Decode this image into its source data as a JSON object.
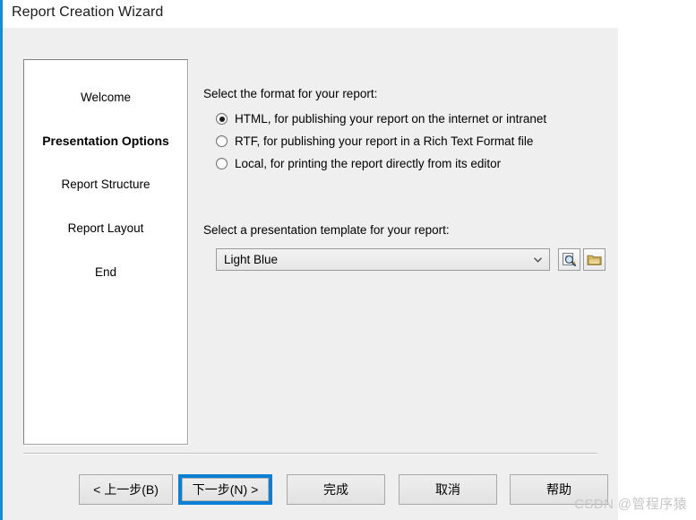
{
  "window": {
    "title": "Report Creation Wizard",
    "accent_color": "#1a8ad4",
    "dialog_background": "#efefef"
  },
  "steps_panel": {
    "items": [
      {
        "label": "Welcome",
        "active": false
      },
      {
        "label": "Presentation Options",
        "active": true
      },
      {
        "label": "Report Structure",
        "active": false
      },
      {
        "label": "Report Layout",
        "active": false
      },
      {
        "label": "End",
        "active": false
      }
    ]
  },
  "content": {
    "format_prompt": "Select the format for your report:",
    "format_options": [
      {
        "label": "HTML, for publishing your report on the internet or intranet",
        "selected": true
      },
      {
        "label": "RTF, for publishing your report in a Rich Text Format file",
        "selected": false
      },
      {
        "label": "Local, for printing the report directly from its editor",
        "selected": false
      }
    ],
    "template_prompt": "Select a presentation template for your report:",
    "template_combo": {
      "value": "Light Blue",
      "arrow_icon": "chevron-down-icon"
    },
    "preview_button_icon": "document-preview-icon",
    "browse_button_icon": "folder-open-icon"
  },
  "footer": {
    "buttons": [
      {
        "id": "back",
        "label": "< 上一步(B)",
        "focused": false
      },
      {
        "id": "next",
        "label": "下一步(N) >",
        "focused": true
      },
      {
        "id": "finish",
        "label": "完成",
        "focused": false
      },
      {
        "id": "cancel",
        "label": "取消",
        "focused": false
      },
      {
        "id": "help",
        "label": "帮助",
        "focused": false
      }
    ],
    "focus_color": "#0a7fd4"
  },
  "watermark": {
    "text": "CSDN @管程序猿"
  }
}
